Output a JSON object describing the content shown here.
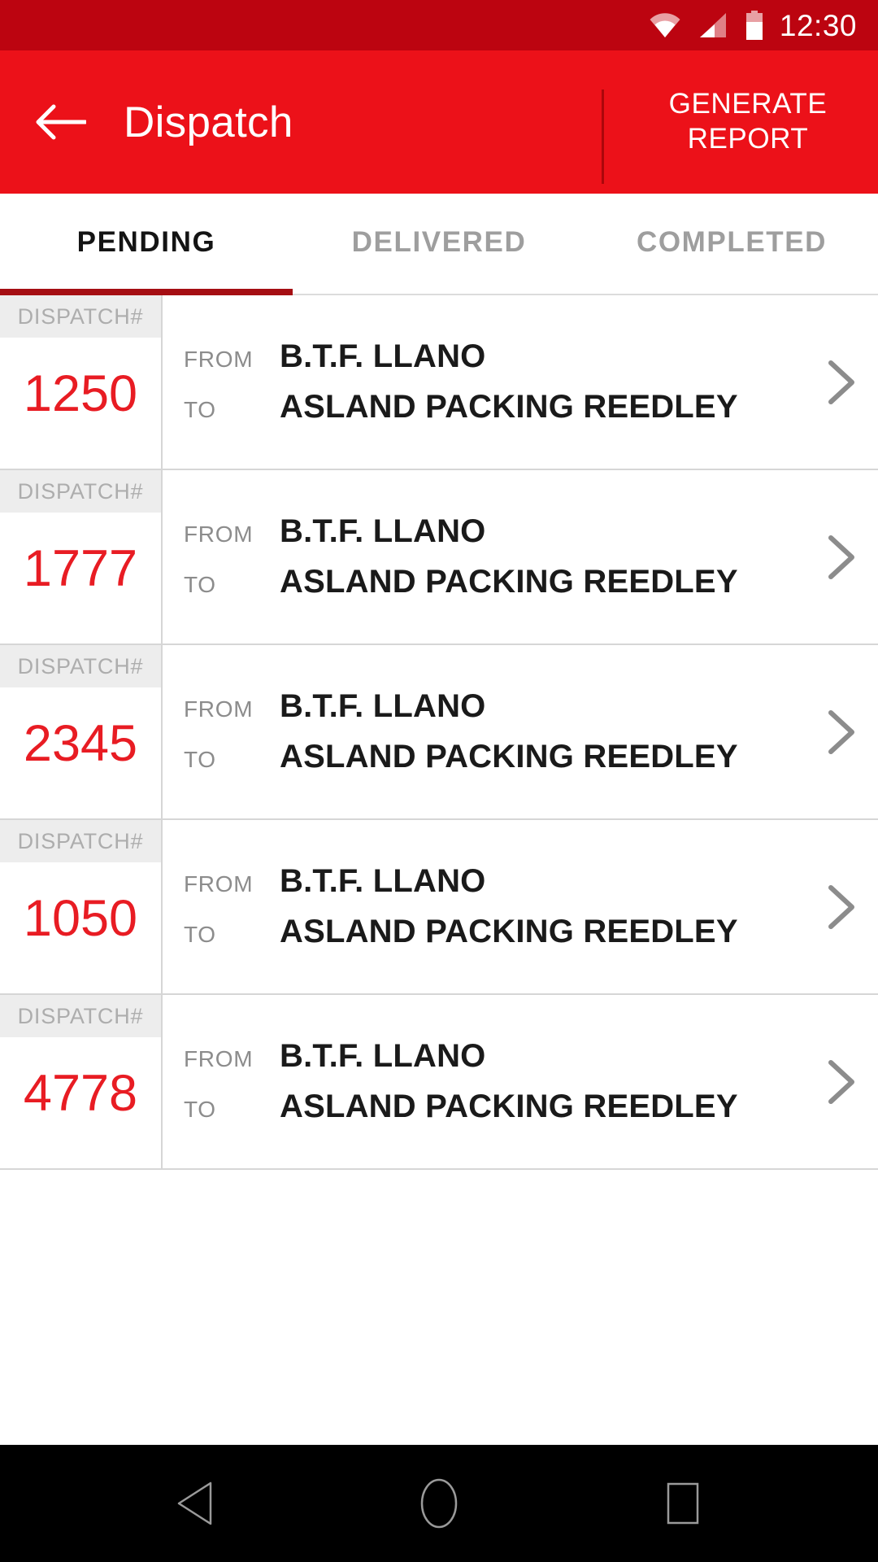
{
  "status_bar": {
    "time": "12:30",
    "icons": [
      "wifi-icon",
      "cell-signal-icon",
      "battery-icon"
    ],
    "background_color": "#bc0410"
  },
  "app_bar": {
    "back_icon": "arrow-back-icon",
    "title": "Dispatch",
    "action_line1": "GENERATE",
    "action_line2": "REPORT",
    "background_color": "#ec1119"
  },
  "tabs": {
    "items": [
      {
        "label": "PENDING",
        "active": true
      },
      {
        "label": "DELIVERED",
        "active": false
      },
      {
        "label": "COMPLETED",
        "active": false
      }
    ],
    "indicator_color": "#a50e13"
  },
  "list": {
    "dispatch_header_label": "DISPATCH#",
    "from_label": "FROM",
    "to_label": "TO",
    "chevron_icon": "chevron-right-icon",
    "number_color": "#e81c23",
    "rows": [
      {
        "number": "1250",
        "from": "B.T.F. LLANO",
        "to": "ASLAND PACKING REEDLEY"
      },
      {
        "number": "1777",
        "from": "B.T.F. LLANO",
        "to": "ASLAND PACKING REEDLEY"
      },
      {
        "number": "2345",
        "from": "B.T.F. LLANO",
        "to": "ASLAND PACKING REEDLEY"
      },
      {
        "number": "1050",
        "from": "B.T.F. LLANO",
        "to": "ASLAND PACKING REEDLEY"
      },
      {
        "number": "4778",
        "from": "B.T.F. LLANO",
        "to": "ASLAND PACKING REEDLEY"
      }
    ]
  },
  "nav_bar": {
    "back_icon": "nav-back-triangle-icon",
    "home_icon": "nav-home-circle-icon",
    "recents_icon": "nav-recents-square-icon",
    "background_color": "#000000"
  }
}
